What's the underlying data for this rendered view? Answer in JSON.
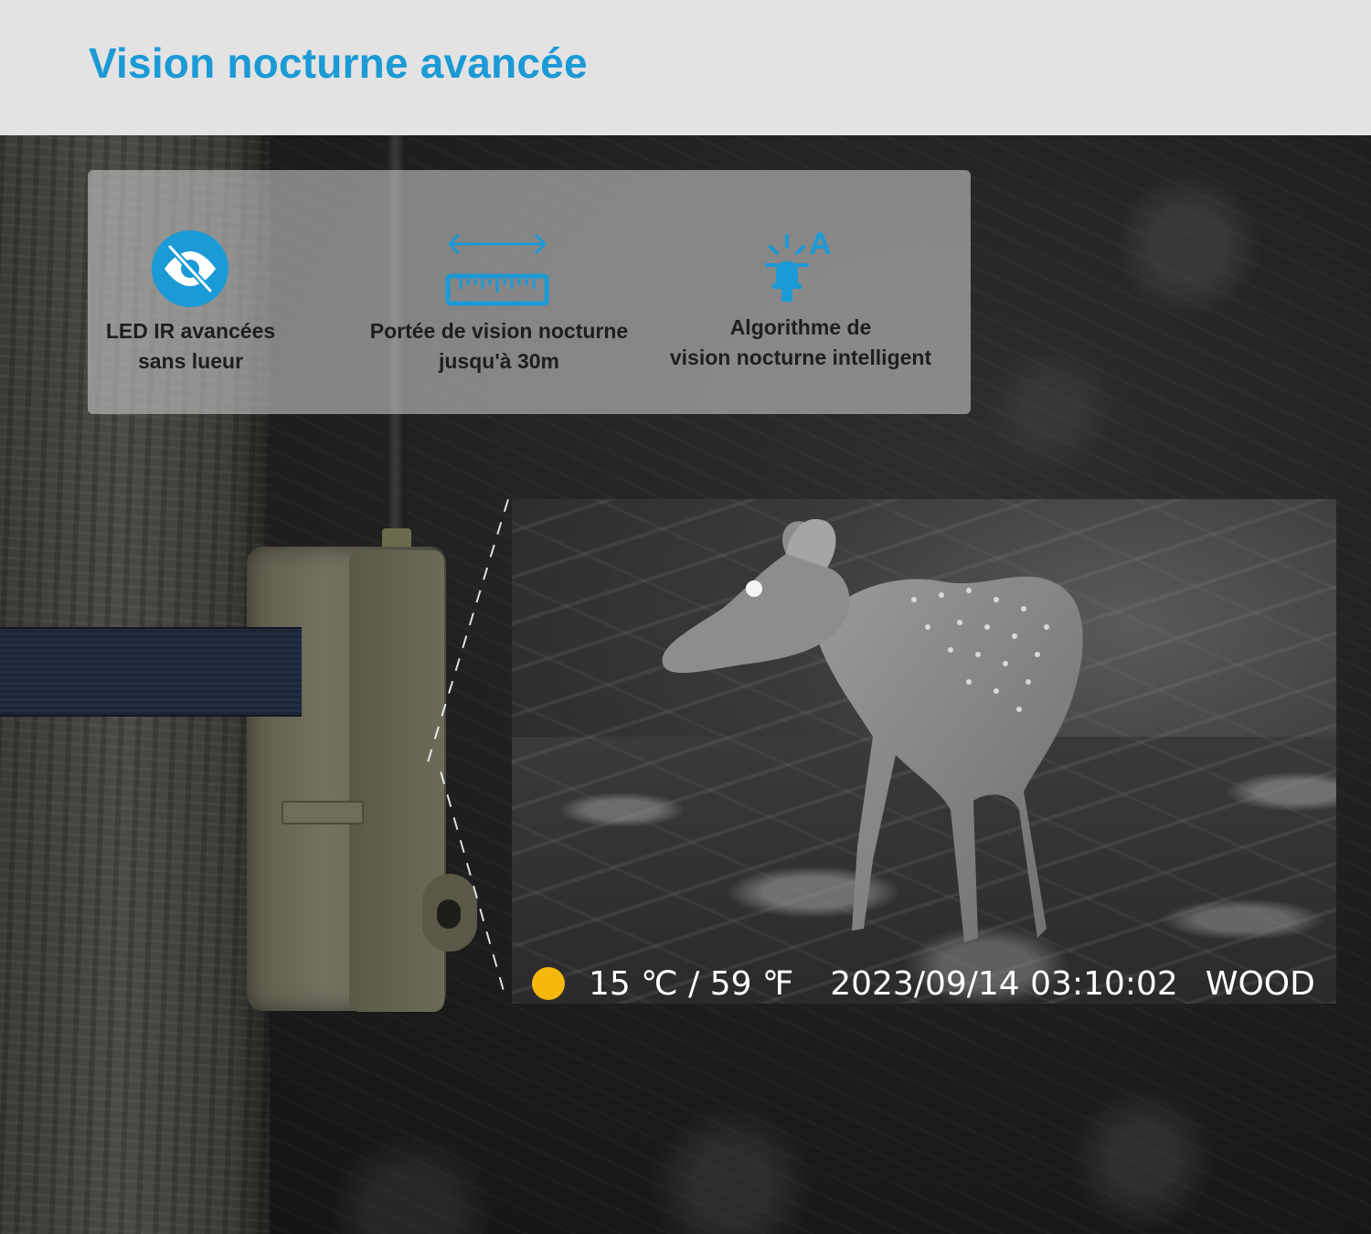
{
  "header": {
    "title": "Vision nocturne avancée"
  },
  "features": [
    {
      "icon": "eye-slash-icon",
      "label": "LED IR avancées\nsans lueur"
    },
    {
      "icon": "ruler-range-icon",
      "label": "Portée de vision nocturne\njusqu'à 30m"
    },
    {
      "icon": "smart-light-icon",
      "label": "Algorithme de\nvision nocturne intelligent"
    }
  ],
  "osd": {
    "temperature": "15 ℃ / 59 ℉",
    "datetime": "2023/09/14 03:10:02",
    "location": "WOOD"
  },
  "colors": {
    "accent": "#1b9ad6",
    "moon": "#f6b80d"
  }
}
